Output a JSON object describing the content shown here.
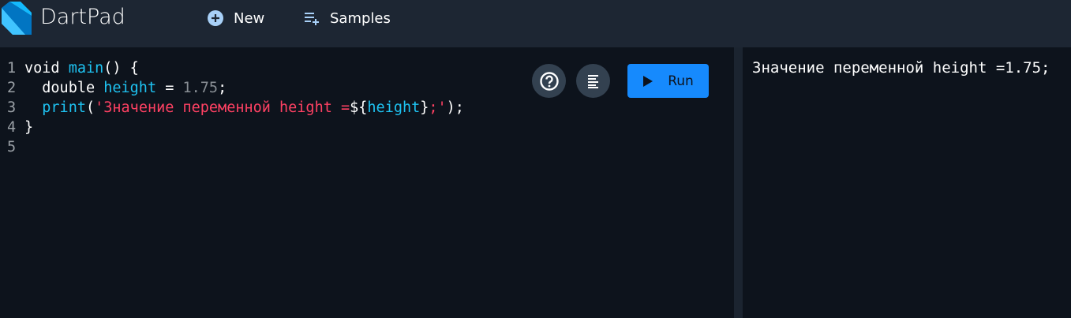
{
  "header": {
    "title": "DartPad",
    "new_label": "New",
    "samples_label": "Samples",
    "icons": {
      "new": "add-circle-icon",
      "samples": "playlist-add-icon"
    }
  },
  "editor": {
    "line_numbers": [
      "1",
      "2",
      "3",
      "4",
      "5"
    ],
    "lines": [
      [
        {
          "t": "void ",
          "k": "plain"
        },
        {
          "t": "main",
          "k": "fn"
        },
        {
          "t": "() {",
          "k": "plain"
        }
      ],
      [
        {
          "t": "  double ",
          "k": "plain"
        },
        {
          "t": "height",
          "k": "fn"
        },
        {
          "t": " = ",
          "k": "plain"
        },
        {
          "t": "1.75",
          "k": "num"
        },
        {
          "t": ";",
          "k": "plain"
        }
      ],
      [
        {
          "t": "  ",
          "k": "plain"
        },
        {
          "t": "print",
          "k": "fn"
        },
        {
          "t": "(",
          "k": "plain"
        },
        {
          "t": "'Значение переменной height =",
          "k": "str"
        },
        {
          "t": "${",
          "k": "plain"
        },
        {
          "t": "height",
          "k": "fn"
        },
        {
          "t": "}",
          "k": "plain"
        },
        {
          "t": ";'",
          "k": "str"
        },
        {
          "t": ");",
          "k": "plain"
        }
      ],
      [
        {
          "t": "}",
          "k": "plain"
        }
      ],
      []
    ],
    "run_label": "Run"
  },
  "output": {
    "text": "Значение переменной height =1.75;"
  },
  "colors": {
    "header": "#1d2633",
    "background": "#0d131c",
    "run": "#168afd",
    "string": "#ff4163",
    "identifier": "#1ec3f2",
    "number": "#888e94"
  }
}
